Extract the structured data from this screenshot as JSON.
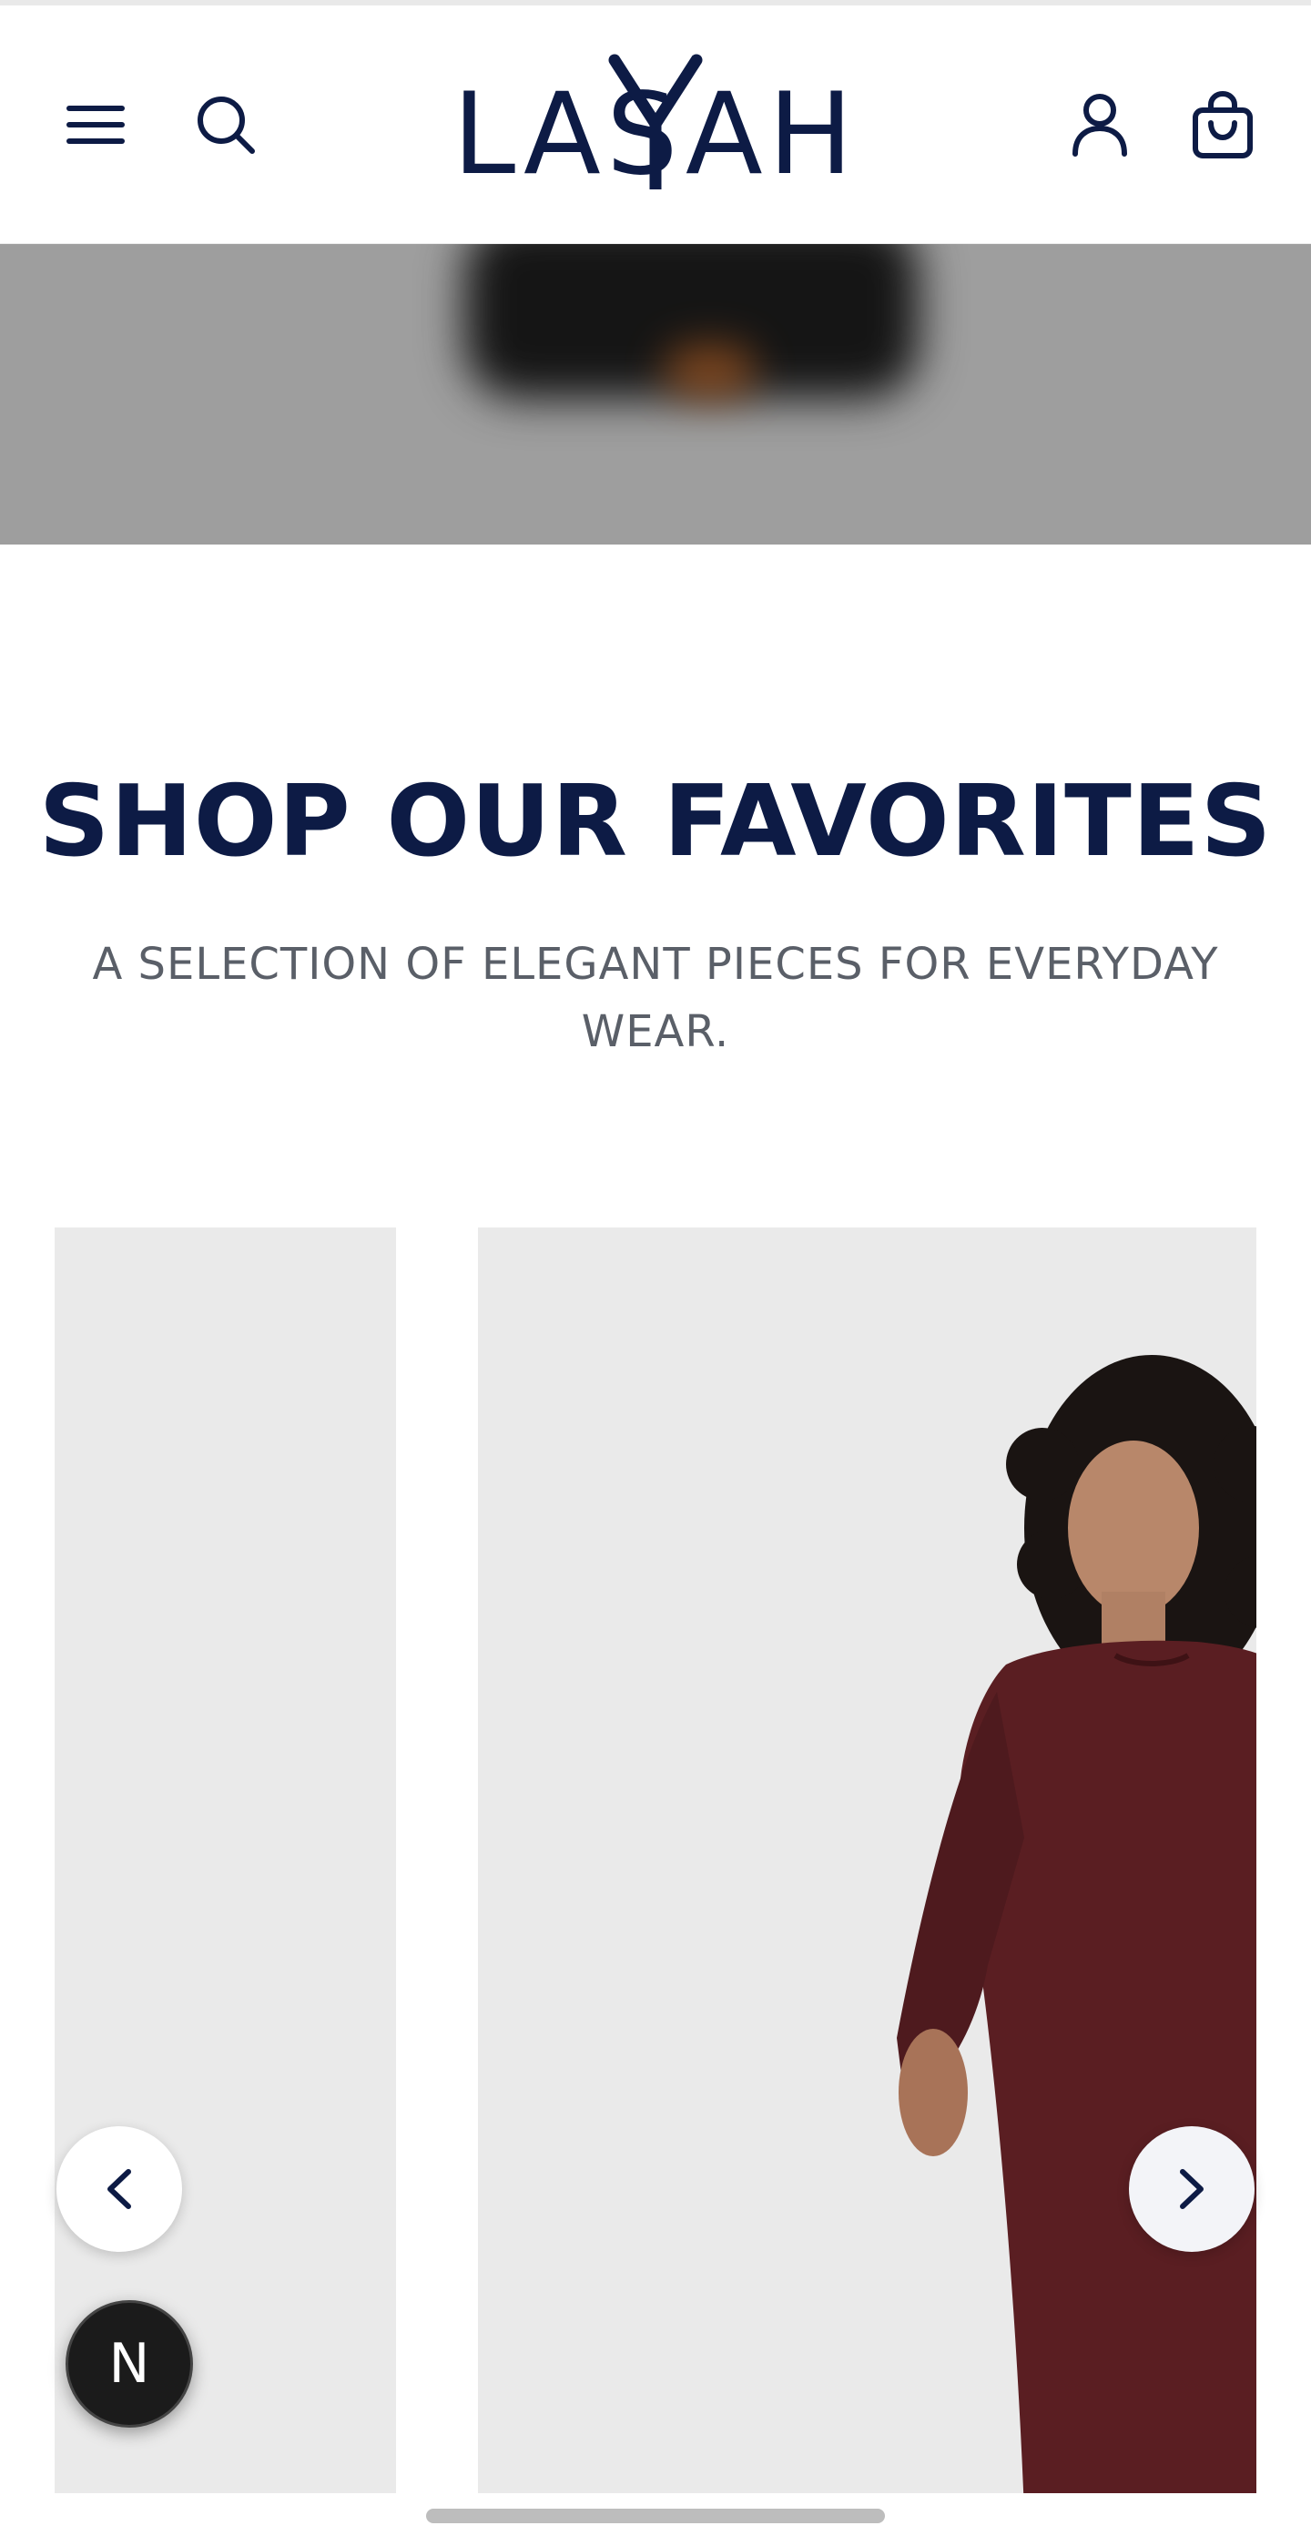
{
  "brand": {
    "logo_text": "LASAH"
  },
  "header": {
    "icons": [
      "menu-icon",
      "search-icon",
      "account-icon",
      "shopping-bag-icon"
    ]
  },
  "section": {
    "title": "SHOP OUR FAVORITES",
    "subtitle": "A SELECTION OF ELEGANT PIECES FOR EVERYDAY WEAR."
  },
  "carousel": {
    "prev_icon": "chevron-left-icon",
    "next_icon": "chevron-right-icon"
  },
  "badge": {
    "label": "N"
  },
  "colors": {
    "brand_navy": "#0d1b45",
    "subtitle_gray": "#5a5f68",
    "card_bg": "#eaeaea",
    "dress_maroon": "#5a1e22"
  }
}
